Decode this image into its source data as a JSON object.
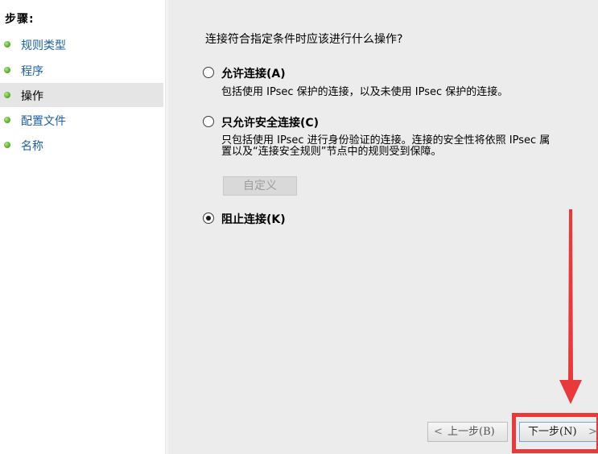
{
  "steps": {
    "heading": "步骤:",
    "items": [
      {
        "label": "规则类型"
      },
      {
        "label": "程序"
      },
      {
        "label": "操作"
      },
      {
        "label": "配置文件"
      },
      {
        "label": "名称"
      }
    ],
    "selected_index": 2
  },
  "main": {
    "question": "连接符合指定条件时应该进行什么操作?",
    "options": [
      {
        "label": "允许连接(A)",
        "description": [
          "包括使用 IPsec 保护的连接，以及未使用 IPsec 保护的连接。"
        ],
        "checked": false
      },
      {
        "label": "只允许安全连接(C)",
        "description": [
          "只包括使用 IPsec 进行身份验证的连接。连接的安全性将依照 IPsec 属",
          "置以及“连接安全规则”节点中的规则受到保障。"
        ],
        "checked": false
      },
      {
        "label": "阻止连接(K)",
        "description": [],
        "checked": true
      }
    ],
    "customize_label": "自定义"
  },
  "buttons": {
    "back_label": "上一步(B)",
    "next_label": "下一步(N)"
  },
  "colors": {
    "annotation": "#e8393b",
    "link": "#1c5fa8"
  }
}
